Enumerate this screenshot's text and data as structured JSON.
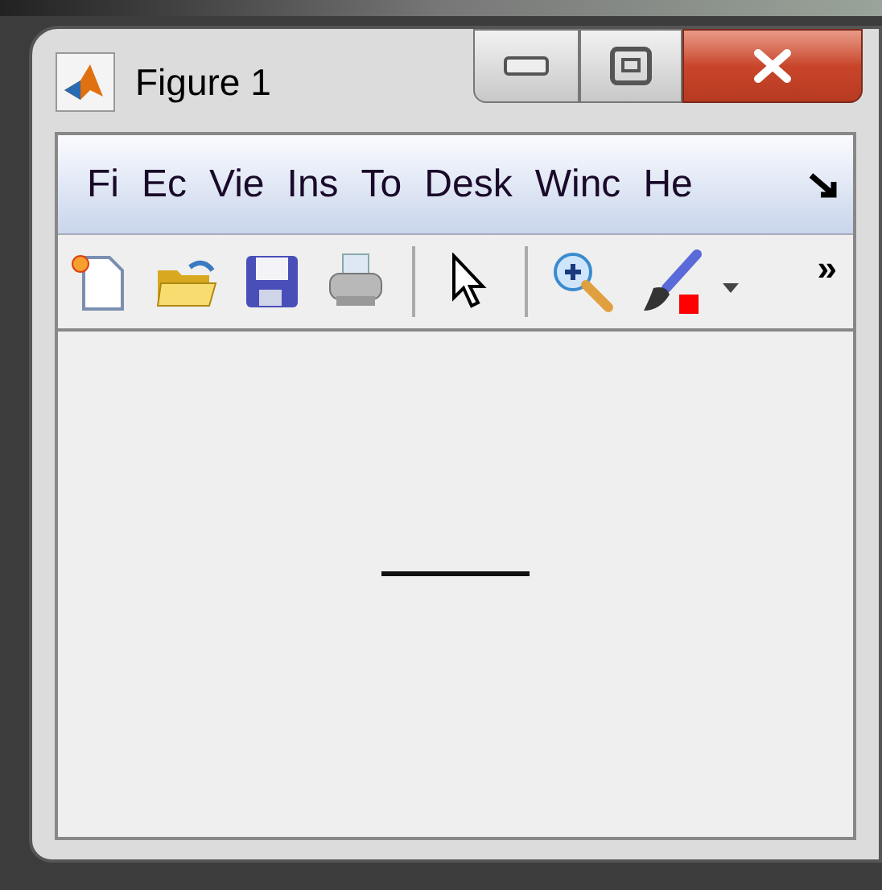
{
  "window": {
    "title": "Figure 1"
  },
  "menu": [
    {
      "label": "Fi"
    },
    {
      "label": "Ec"
    },
    {
      "label": "Vie"
    },
    {
      "label": "Ins"
    },
    {
      "label": "To"
    },
    {
      "label": "Desk"
    },
    {
      "label": "Winc"
    },
    {
      "label": "He"
    }
  ],
  "toolbar": {
    "overflow": "»"
  }
}
